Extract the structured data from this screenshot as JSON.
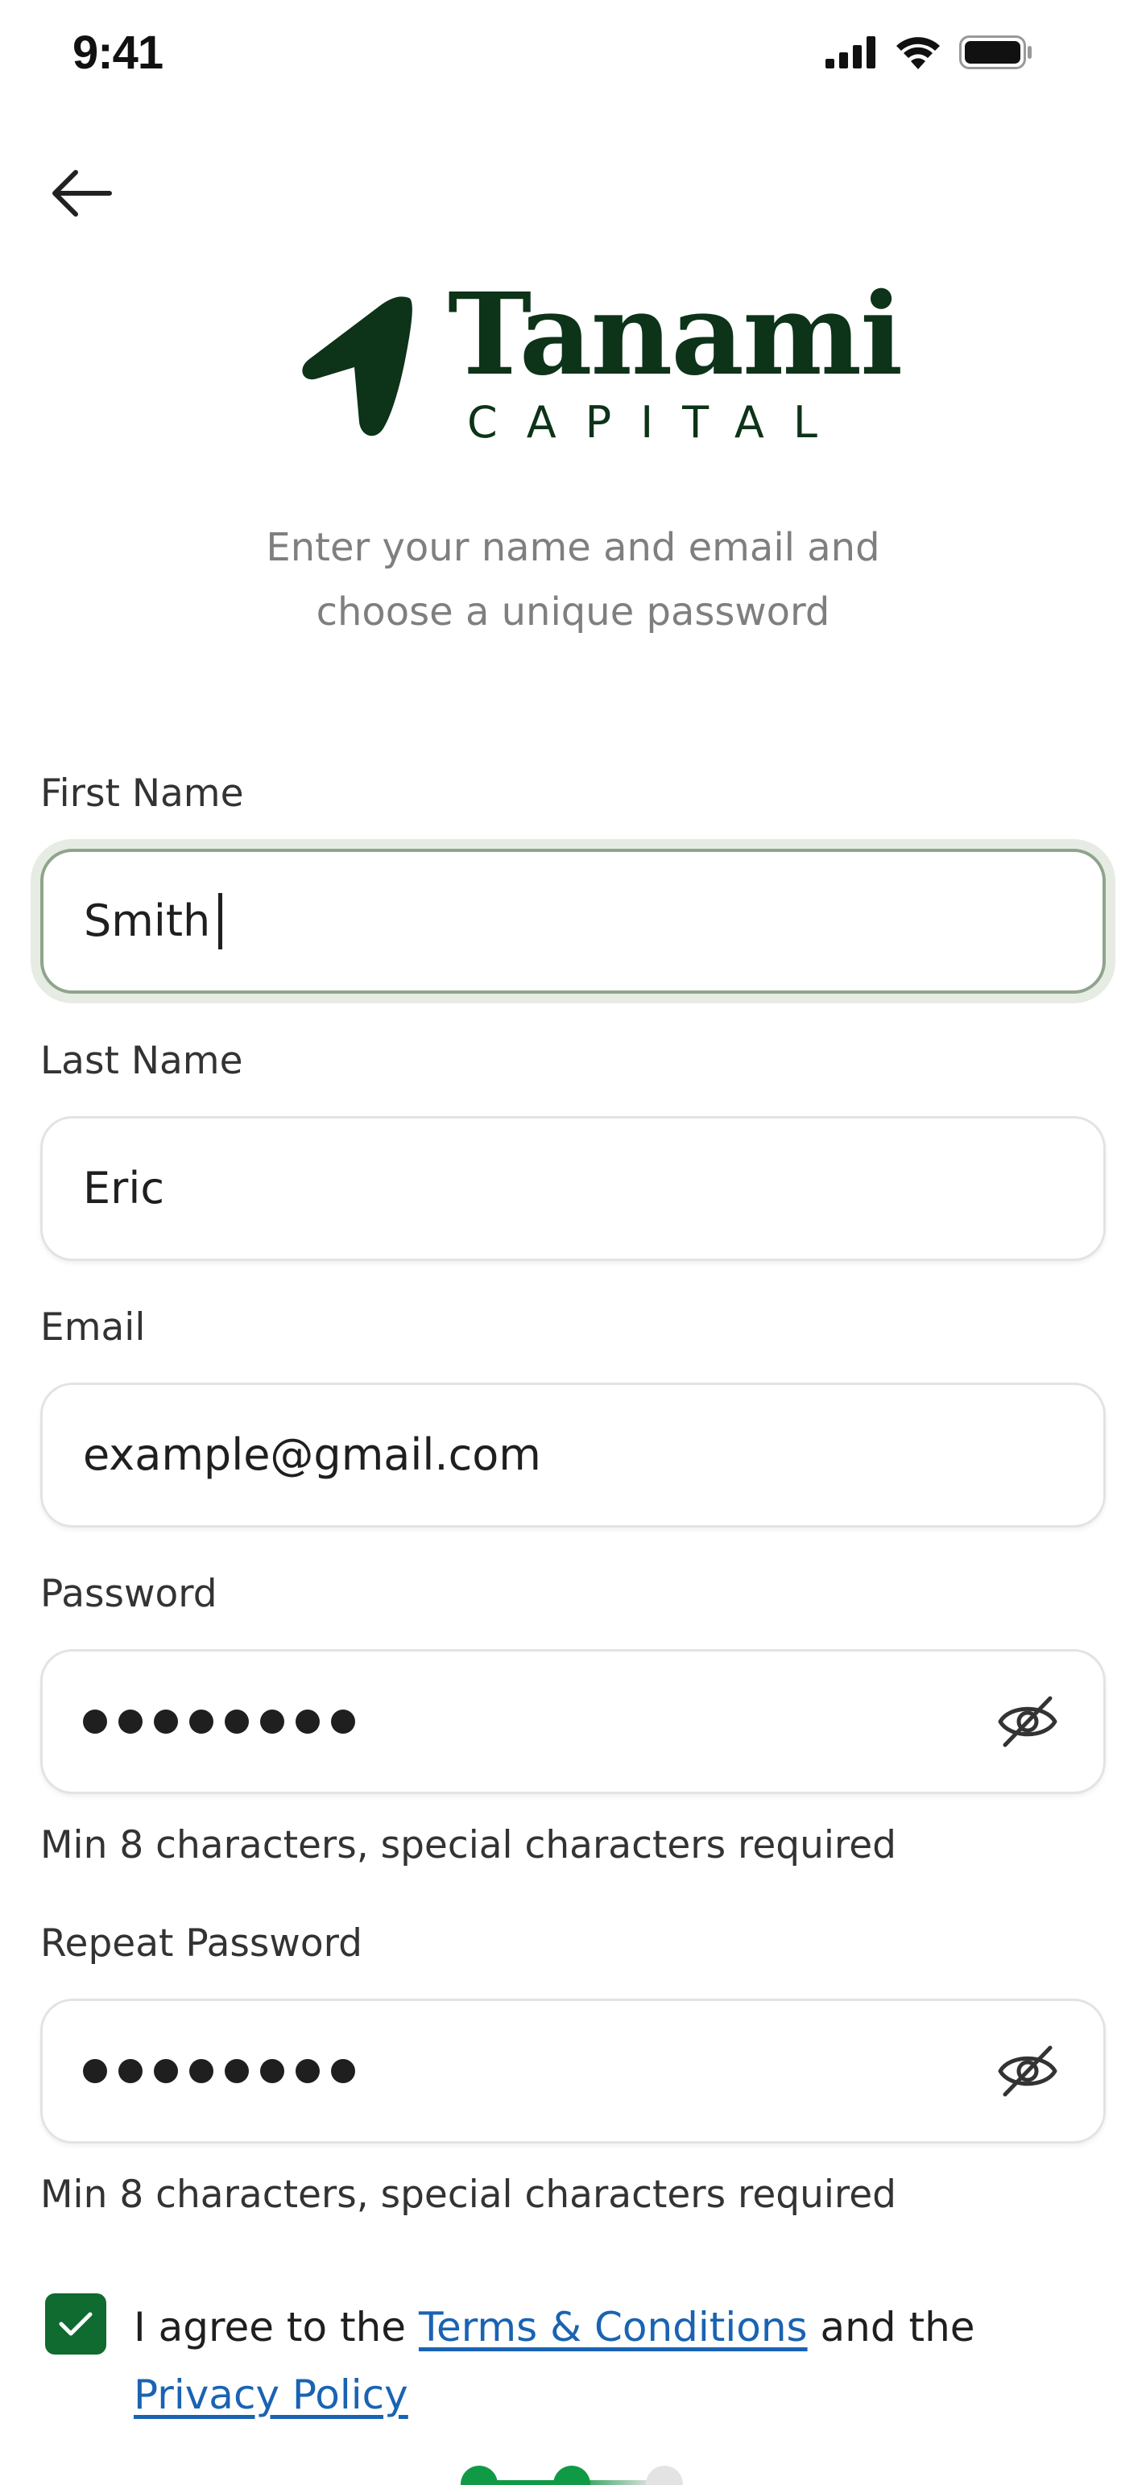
{
  "status_bar": {
    "time": "9:41"
  },
  "header": {
    "back_icon": "arrow-left-icon"
  },
  "logo": {
    "word": "Tanami",
    "sub": "CAPITAL",
    "color": "#0d3319"
  },
  "subtitle": {
    "line1": "Enter your name and email and",
    "line2": "choose a unique password"
  },
  "form": {
    "first_name": {
      "label": "First Name",
      "value": "Smith"
    },
    "last_name": {
      "label": "Last Name",
      "value": "Eric"
    },
    "email": {
      "label": "Email",
      "value": "example@gmail.com"
    },
    "password": {
      "label": "Password",
      "value": "••••••••",
      "hint": "Min 8 characters, special characters required",
      "toggle_icon": "eye-off-icon"
    },
    "repeat_password": {
      "label": "Repeat Password",
      "value": "••••••••",
      "hint": "Min 8 characters, special characters required",
      "toggle_icon": "eye-off-icon"
    }
  },
  "terms": {
    "checked": true,
    "prefix": "I agree to the ",
    "terms_link": "Terms & Conditions",
    "middle": " and the ",
    "privacy_link": "Privacy Policy"
  },
  "progress": {
    "steps_total": 3,
    "current_step": 2,
    "accent": "#119a46",
    "inactive": "#e3e3e3"
  },
  "colors": {
    "brand": "#0d3319",
    "accent": "#0f6b30",
    "link": "#1a63b2",
    "focus_border": "#8fa48c"
  }
}
